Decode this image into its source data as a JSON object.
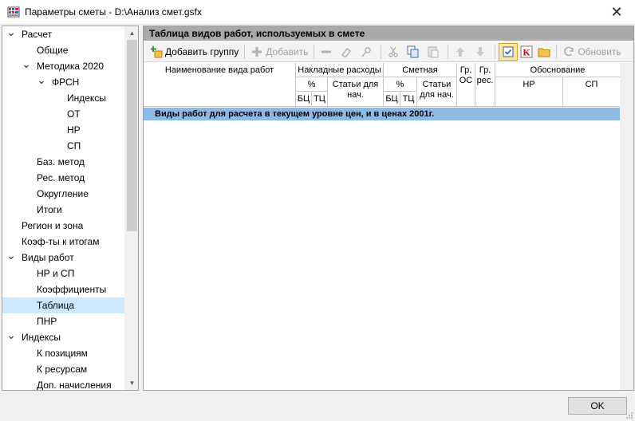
{
  "window": {
    "title": "Параметры сметы - D:\\Анализ смет.gsfx",
    "close_glyph": "✕"
  },
  "tree": {
    "items": [
      {
        "label": "Расчет",
        "level": 0,
        "expanded": true
      },
      {
        "label": "Общие",
        "level": 1
      },
      {
        "label": "Методика 2020",
        "level": 1,
        "expanded": true
      },
      {
        "label": "ФРСН",
        "level": 2,
        "expanded": true
      },
      {
        "label": "Индексы",
        "level": 3
      },
      {
        "label": "ОТ",
        "level": 3
      },
      {
        "label": "НР",
        "level": 3
      },
      {
        "label": "СП",
        "level": 3
      },
      {
        "label": "Баз. метод",
        "level": 1
      },
      {
        "label": "Рес. метод",
        "level": 1
      },
      {
        "label": "Округление",
        "level": 1
      },
      {
        "label": "Итоги",
        "level": 1
      },
      {
        "label": "Регион и зона",
        "level": 0
      },
      {
        "label": "Коэф-ты к итогам",
        "level": 0
      },
      {
        "label": "Виды работ",
        "level": 0,
        "expanded": true
      },
      {
        "label": "НР и СП",
        "level": 1
      },
      {
        "label": "Коэффициенты",
        "level": 1
      },
      {
        "label": "Таблица",
        "level": 1,
        "selected": true
      },
      {
        "label": "ПНР",
        "level": 1
      },
      {
        "label": "Индексы",
        "level": 0,
        "expanded": true
      },
      {
        "label": "К позициям",
        "level": 1
      },
      {
        "label": "К ресурсам",
        "level": 1
      },
      {
        "label": "Доп. начисления",
        "level": 1
      }
    ]
  },
  "panel": {
    "header": "Таблица видов работ, используемых в смете",
    "toolbar": {
      "add_group": "Добавить группу",
      "add": "Добавить",
      "refresh": "Обновить"
    },
    "columns": {
      "name": "Наименование вида работ",
      "overhead": "Накладные расходы",
      "profit": "Сметная прибыль",
      "pct": "%",
      "items_for_charge": "Статьи для нач.",
      "bc": "БЦ",
      "tc": "ТЦ",
      "gr_os": "Гр. ОС",
      "gr_res": "Гр. рес.",
      "justification": "Обоснование",
      "nr": "НР",
      "sp": "СП"
    },
    "group_row": "Виды работ для расчета в текущем уровне цен, и в ценах 2001г."
  },
  "footer": {
    "ok": "OK"
  },
  "colors": {
    "selected_tree": "#cce8ff",
    "group_row": "#8ebae6",
    "panel_header": "#a9a9a9"
  }
}
